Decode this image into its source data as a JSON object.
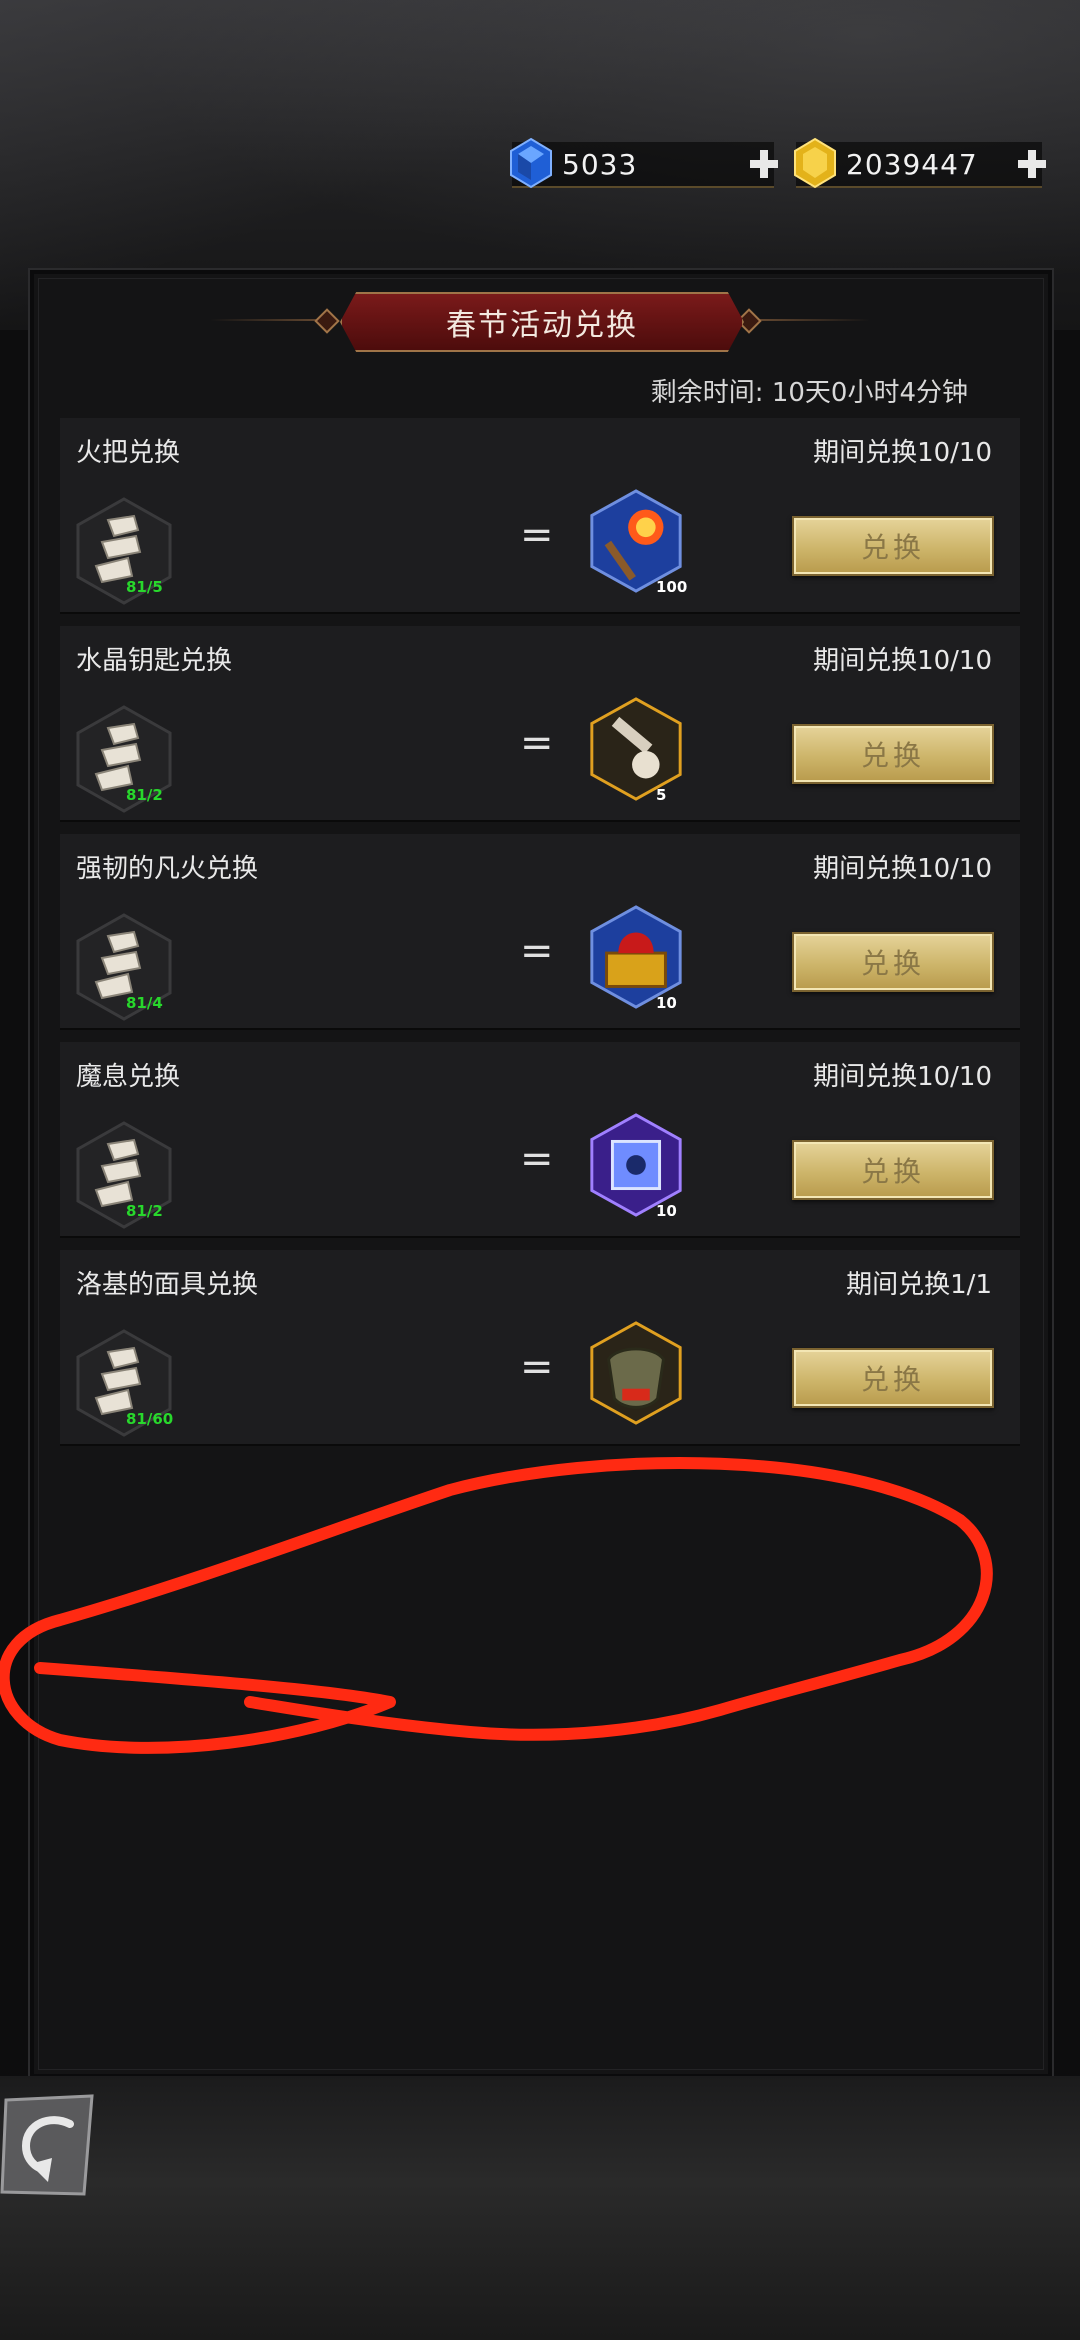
{
  "currency": {
    "gems": "5033",
    "gold": "2039447"
  },
  "title": "春节活动兑换",
  "timer": "剩余时间: 10天0小时4分钟",
  "exchanges": [
    {
      "name": "火把兑换",
      "limit": "期间兑换10/10",
      "material_count": "81/5",
      "reward_count": "100",
      "button": "兑换",
      "reward_icon": "torch-icon"
    },
    {
      "name": "水晶钥匙兑换",
      "limit": "期间兑换10/10",
      "material_count": "81/2",
      "reward_count": "5",
      "button": "兑换",
      "reward_icon": "crystal-key-icon"
    },
    {
      "name": "强韧的凡火兑换",
      "limit": "期间兑换10/10",
      "material_count": "81/4",
      "reward_count": "10",
      "button": "兑换",
      "reward_icon": "fire-chest-icon"
    },
    {
      "name": "魔息兑换",
      "limit": "期间兑换10/10",
      "material_count": "81/2",
      "reward_count": "10",
      "button": "兑换",
      "reward_icon": "magic-cube-icon"
    },
    {
      "name": "洛基的面具兑换",
      "limit": "期间兑换1/1",
      "material_count": "81/60",
      "reward_count": "",
      "button": "兑换",
      "reward_icon": "loki-mask-icon"
    }
  ],
  "colors": {
    "panel": "#141415",
    "card": "#1d1d1f",
    "button_gold": "#cdb56a",
    "count_green": "#28d82c",
    "title_red": "#7a1a1a",
    "annotation_red": "#ff2a12"
  }
}
